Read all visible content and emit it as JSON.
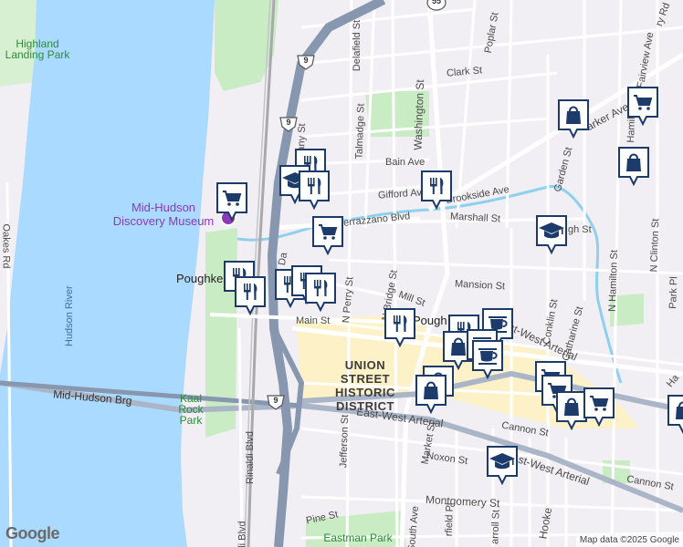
{
  "colors": {
    "water": "#aadaff",
    "river_stream": "#8fd0ee",
    "park": "#c9ecc4",
    "road": "#ffffff",
    "road_edge": "#d8d6dc",
    "highway": "#8797b0",
    "highway_light": "#b8c6d9",
    "arterial": "#aab6c8",
    "rail": "#a9a9ad",
    "district": "#fdf1c7",
    "marker_fill": "#ffffff",
    "marker_border": "#1c3b6b",
    "marker_icon": "#1c3b6b",
    "poi_purple": "#8c3ab5"
  },
  "labels": {
    "highland_park": "Highland Landing Park",
    "mid_hudson_museum": "Mid-Hudson Discovery Museum",
    "hudson_river": "Hudson River",
    "mid_hudson_brg": "Mid-Hudson Brg",
    "kaal_rock_park": "Kaal Rock Park",
    "union_street_district": "UNION STREET HISTORIC DISTRICT",
    "eastman_park": "Eastman Park",
    "pough_left": "Poughke",
    "pough_center": "Pough",
    "oakes_rd": "Oakes Rd",
    "rinaldi_blvd_1": "Rinaldi Blvd",
    "rinaldi_blvd_2": "di Blvd",
    "delafield_st": "Delafield St",
    "poplar_st": "Poplar St",
    "clark_st": "Clark St",
    "fairview_ave": "Fairview Ave",
    "ry_rd": "ry Rd",
    "washington_st": "Washington St",
    "talmadge_st": "Talmadge St",
    "any_st": "any St",
    "bain_ave": "Bain Ave",
    "gifford_ave": "Gifford Av",
    "brookside_ave": "Brookside Ave",
    "marshall_st": "Marshall St",
    "verrazzano_blvd": "errazzano Blvd",
    "garden_st": "Garden St",
    "parker_ave": "arker Ave",
    "hamilton_top": "Hamilt",
    "n_clinton_st": "N Clinton St",
    "n_hamilton_st": "N Hamilton St",
    "park_pl": "Park Pl",
    "igh_st": "gh St",
    "mansion_st": "Mansion St",
    "mill_st": "Mill St",
    "n_bridge_st": "N Bridge St",
    "n_perry_st": "N Perry St",
    "main_st": "Main St",
    "conklin_st": "Conklin St",
    "catharine_st": "Catharine St",
    "east_west_arterial_1": "East-West Arterial",
    "east_west_arterial_2": "East-West Arterial",
    "east_west_arterial_3": "st-West Arterial",
    "cannon_st_1": "Cannon St",
    "cannon_st_2": "Cannon St",
    "noxon_st": "Noxon St",
    "market_st": "Market St",
    "jefferson_st": "Jefferson St",
    "montgomery_st": "Montgomery St",
    "pine_st": "Pine St",
    "south_ave": "South Ave",
    "garfield_pl": "rfield Pl",
    "carroll_st": "arroll St",
    "hooker_ave": "Hooke",
    "ha_right": "Ha",
    "da_st": "Da"
  },
  "shields": {
    "route9_top": "9",
    "route9_mid": "9",
    "route9_bottom": "9",
    "route55_top": "55"
  },
  "markers": [
    {
      "icon": "restaurant"
    },
    {
      "icon": "school"
    },
    {
      "icon": "restaurant"
    },
    {
      "icon": "grocery"
    },
    {
      "icon": "grocery"
    },
    {
      "icon": "restaurant"
    },
    {
      "icon": "restaurant"
    },
    {
      "icon": "restaurant"
    },
    {
      "icon": "restaurant"
    },
    {
      "icon": "restaurant"
    },
    {
      "icon": "restaurant"
    },
    {
      "icon": "restaurant"
    },
    {
      "icon": "shopping"
    },
    {
      "icon": "shopping"
    },
    {
      "icon": "grocery"
    },
    {
      "icon": "school"
    },
    {
      "icon": "restaurant"
    },
    {
      "icon": "cafe"
    },
    {
      "icon": "shopping"
    },
    {
      "icon": "cafe"
    },
    {
      "icon": "cafe"
    },
    {
      "icon": "shopping"
    },
    {
      "icon": "shopping"
    },
    {
      "icon": "grocery"
    },
    {
      "icon": "grocery"
    },
    {
      "icon": "shopping"
    },
    {
      "icon": "grocery"
    },
    {
      "icon": "shopping"
    },
    {
      "icon": "school"
    }
  ],
  "google_logo": "Google",
  "attribution": "Map data ©2025 Google"
}
